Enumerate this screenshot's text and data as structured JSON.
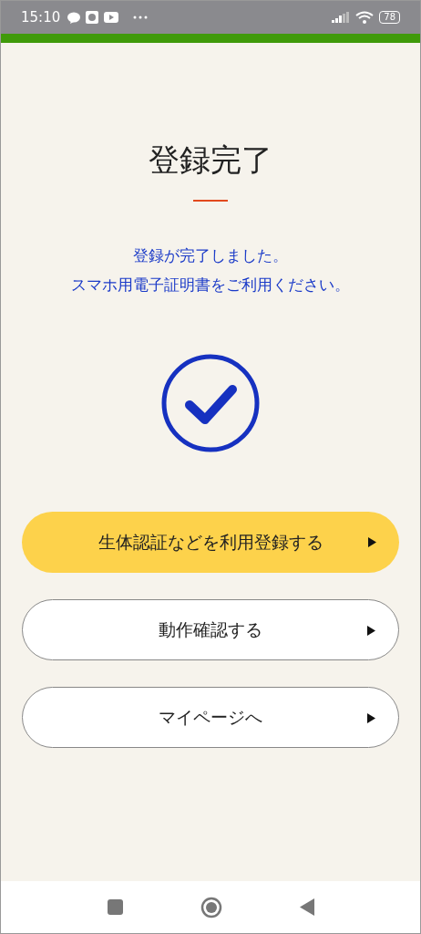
{
  "status_bar": {
    "time": "15:10",
    "battery": "78"
  },
  "title": "登録完了",
  "message": [
    "登録が完了しました。",
    "スマホ用電子証明書をご利用ください。"
  ],
  "buttons": [
    {
      "label": "生体認証などを利用登録する",
      "kind": "primary"
    },
    {
      "label": "動作確認する",
      "kind": "secondary"
    },
    {
      "label": "マイページへ",
      "kind": "secondary"
    }
  ]
}
